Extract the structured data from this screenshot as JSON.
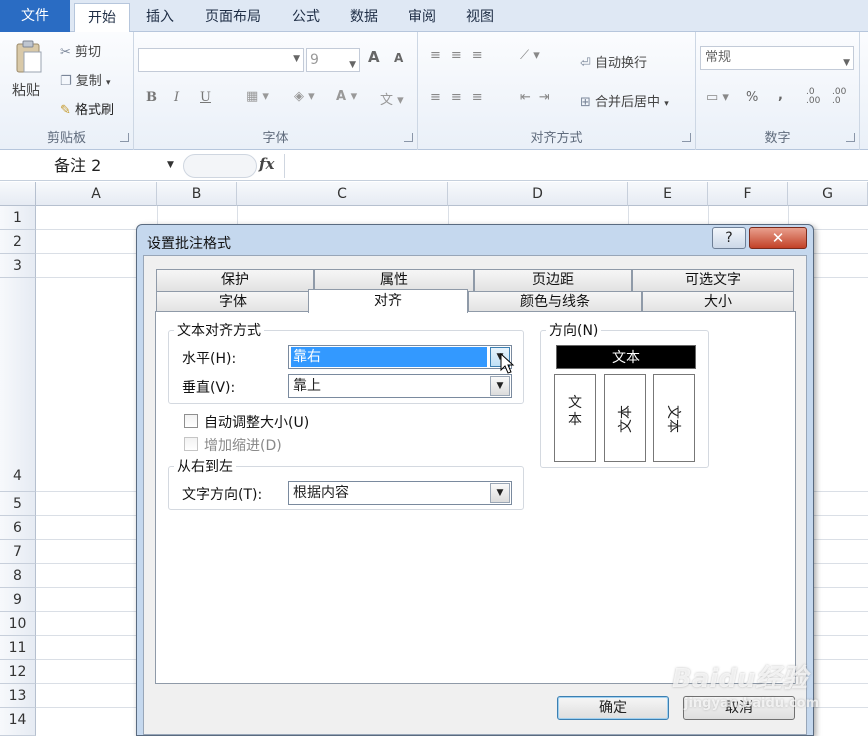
{
  "ribbon_tabs": {
    "file": "文件",
    "home": "开始",
    "insert": "插入",
    "page_layout": "页面布局",
    "formulas": "公式",
    "data": "数据",
    "review": "审阅",
    "view": "视图"
  },
  "clipboard": {
    "paste": "粘贴",
    "cut": "剪切",
    "copy": "复制",
    "format_painter": "格式刷",
    "group_label": "剪贴板"
  },
  "font": {
    "font_name": "",
    "font_size": "9",
    "bold": "B",
    "italic": "I",
    "underline": "U",
    "grow": "A",
    "shrink": "A",
    "group_label": "字体"
  },
  "alignment": {
    "wrap_text": "自动换行",
    "merge_center": "合并后居中",
    "group_label": "对齐方式"
  },
  "number": {
    "format": "常规",
    "percent": "%",
    "comma": ",",
    "inc_decimal": ".0 .00",
    "dec_decimal": ".00 .0",
    "group_label": "数字"
  },
  "formula_bar": {
    "name_box": "备注 2",
    "fx": "fx",
    "formula": ""
  },
  "columns": [
    "A",
    "B",
    "C",
    "D",
    "E",
    "F",
    "G"
  ],
  "rows": [
    "1",
    "2",
    "3",
    "4",
    "5",
    "6",
    "7",
    "8",
    "9",
    "10",
    "11",
    "12",
    "13",
    "14"
  ],
  "dialog": {
    "title": "设置批注格式",
    "help_label": "?",
    "close_label": "✕",
    "tabs_back": [
      "保护",
      "属性",
      "页边距",
      "可选文字"
    ],
    "tabs_front": [
      "字体",
      "对齐",
      "颜色与线条",
      "大小"
    ],
    "active_tab": "对齐",
    "text_alignment": {
      "legend": "文本对齐方式",
      "horizontal_label": "水平(H):",
      "horizontal_value": "靠右",
      "vertical_label": "垂直(V):",
      "vertical_value": "靠上"
    },
    "auto_size": {
      "label": "自动调整大小(U)",
      "checked": false
    },
    "add_indent": {
      "label": "增加缩进(D)",
      "checked": false,
      "disabled": true
    },
    "rtl": {
      "legend": "从右到左",
      "direction_label": "文字方向(T):",
      "direction_value": "根据内容"
    },
    "orientation": {
      "legend": "方向(N)",
      "horizontal_text": "文本",
      "vertical_text": "文本",
      "rot_up_text": "文本",
      "rot_down_text": "文本"
    },
    "ok_label": "确定",
    "cancel_label": "取消"
  },
  "watermark": {
    "brand": "Baidu经验",
    "url": "jingyan.baidu.com"
  }
}
